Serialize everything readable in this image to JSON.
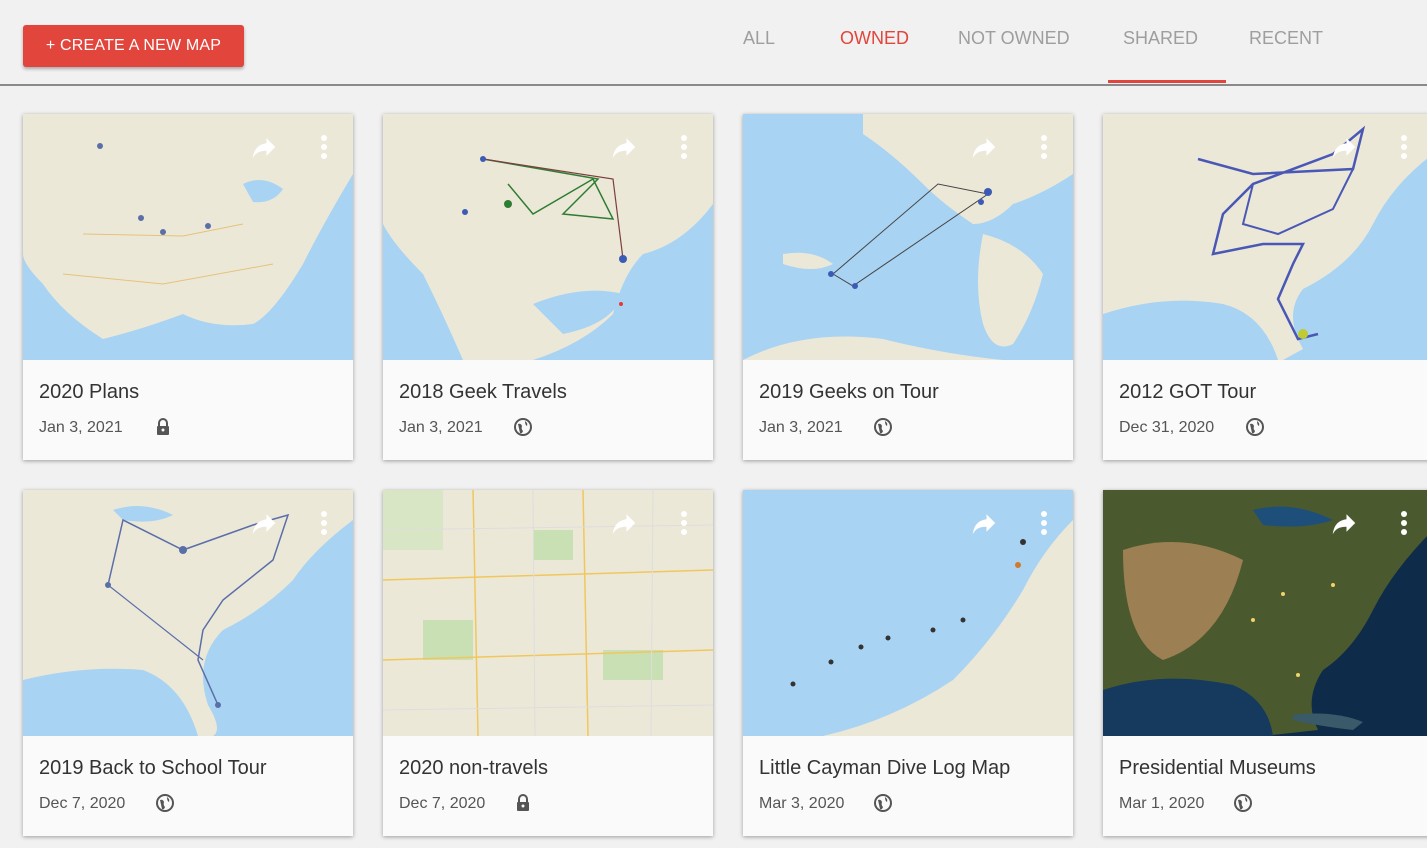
{
  "toolbar": {
    "create_label": "+ CREATE A NEW MAP",
    "tabs": [
      "ALL",
      "OWNED",
      "NOT OWNED",
      "SHARED",
      "RECENT"
    ],
    "active_filter": "OWNED",
    "underlined_tab": "SHARED"
  },
  "colors": {
    "accent": "#e2453c",
    "tab_inactive": "#9e9e9e",
    "water": "#a9d3f2",
    "land": "#ece8d8"
  },
  "maps": [
    {
      "title": "2020 Plans",
      "date": "Jan 3, 2021",
      "visibility": "lock-icon"
    },
    {
      "title": "2018 Geek Travels",
      "date": "Jan 3, 2021",
      "visibility": "globe-icon"
    },
    {
      "title": "2019 Geeks on Tour",
      "date": "Jan 3, 2021",
      "visibility": "globe-icon"
    },
    {
      "title": "2012 GOT Tour",
      "date": "Dec 31, 2020",
      "visibility": "globe-icon"
    },
    {
      "title": "2019 Back to School Tour",
      "date": "Dec 7, 2020",
      "visibility": "globe-icon"
    },
    {
      "title": "2020 non-travels",
      "date": "Dec 7, 2020",
      "visibility": "lock-icon"
    },
    {
      "title": "Little Cayman Dive Log Map",
      "date": "Mar 3, 2020",
      "visibility": "globe-icon"
    },
    {
      "title": "Presidential Museums",
      "date": "Mar 1, 2020",
      "visibility": "globe-icon"
    }
  ]
}
